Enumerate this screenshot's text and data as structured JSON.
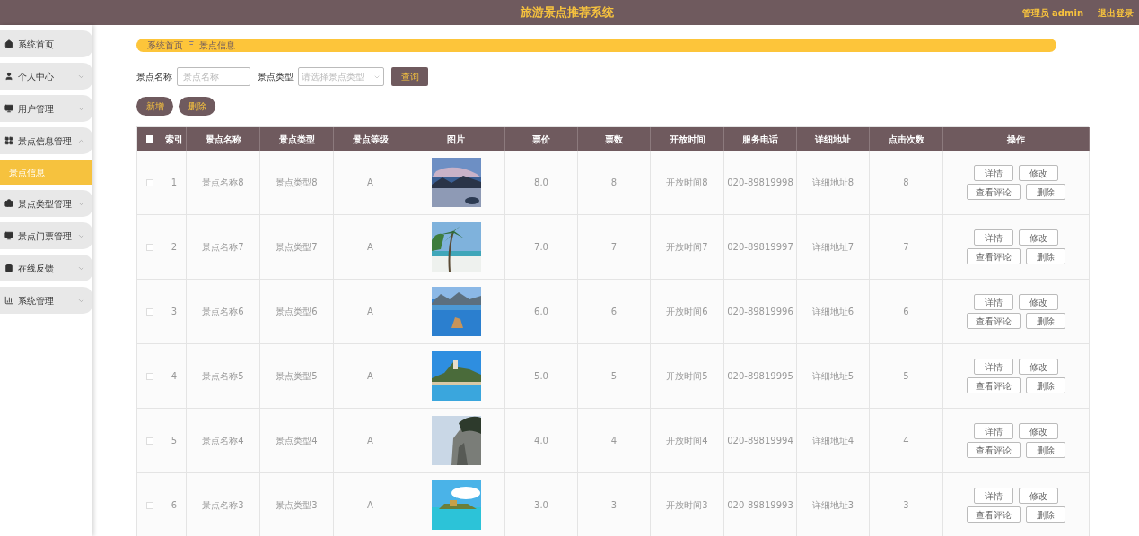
{
  "header": {
    "title": "旅游景点推荐系统",
    "user": "管理员 admin",
    "logout": "退出登录"
  },
  "sidebar": {
    "items": [
      {
        "label": "系统首页",
        "selected": false
      },
      {
        "label": "个人中心",
        "selected": false,
        "expanded": false
      },
      {
        "label": "用户管理",
        "selected": false,
        "expanded": false
      },
      {
        "label": "景点信息管理",
        "selected": false,
        "expanded": true,
        "children": [
          {
            "label": "景点信息",
            "selected": true
          }
        ]
      },
      {
        "label": "景点类型管理",
        "selected": false,
        "expanded": false
      },
      {
        "label": "景点门票管理",
        "selected": false,
        "expanded": false
      },
      {
        "label": "在线反馈",
        "selected": false,
        "expanded": false
      },
      {
        "label": "系统管理",
        "selected": false,
        "expanded": false
      }
    ]
  },
  "breadcrumb": [
    "系统首页",
    "景点信息"
  ],
  "breadcrumb_separator": "Ξ",
  "filters": [
    {
      "label": "景点名称",
      "kind": "input",
      "placeholder": "景点名称"
    },
    {
      "label": "景点类型",
      "kind": "select",
      "placeholder": "请选择景点类型"
    }
  ],
  "search_button": "查询",
  "actions": [
    "新增",
    "删除"
  ],
  "table": {
    "select_all": {
      "checked": false
    },
    "columns": [
      "索引",
      "景点名称",
      "景点类型",
      "景点等级",
      "图片",
      "票价",
      "票数",
      "开放时间",
      "服务电话",
      "详细地址",
      "点击次数",
      "操作"
    ],
    "rows": [
      {
        "checked": false,
        "cells": [
          "1",
          "景点名称8",
          "景点类型8",
          "A",
          {
            "kind": "picture"
          },
          "8.0",
          "8",
          "开放时间8",
          "020-89819998",
          "详细地址8",
          "8"
        ],
        "buttons": [
          "详情",
          "修改",
          "查看评论",
          "删除"
        ]
      },
      {
        "checked": false,
        "cells": [
          "2",
          "景点名称7",
          "景点类型7",
          "A",
          {
            "kind": "picture"
          },
          "7.0",
          "7",
          "开放时间7",
          "020-89819997",
          "详细地址7",
          "7"
        ],
        "buttons": [
          "详情",
          "修改",
          "查看评论",
          "删除"
        ]
      },
      {
        "checked": false,
        "cells": [
          "3",
          "景点名称6",
          "景点类型6",
          "A",
          {
            "kind": "picture"
          },
          "6.0",
          "6",
          "开放时间6",
          "020-89819996",
          "详细地址6",
          "6"
        ],
        "buttons": [
          "详情",
          "修改",
          "查看评论",
          "删除"
        ]
      },
      {
        "checked": false,
        "cells": [
          "4",
          "景点名称5",
          "景点类型5",
          "A",
          {
            "kind": "picture"
          },
          "5.0",
          "5",
          "开放时间5",
          "020-89819995",
          "详细地址5",
          "5"
        ],
        "buttons": [
          "详情",
          "修改",
          "查看评论",
          "删除"
        ]
      },
      {
        "checked": false,
        "cells": [
          "5",
          "景点名称4",
          "景点类型4",
          "A",
          {
            "kind": "picture"
          },
          "4.0",
          "4",
          "开放时间4",
          "020-89819994",
          "详细地址4",
          "4"
        ],
        "buttons": [
          "详情",
          "修改",
          "查看评论",
          "删除"
        ]
      },
      {
        "checked": false,
        "cells": [
          "6",
          "景点名称3",
          "景点类型3",
          "A",
          {
            "kind": "picture"
          },
          "3.0",
          "3",
          "开放时间3",
          "020-89819993",
          "详细地址3",
          "3"
        ],
        "buttons": [
          "详情",
          "修改",
          "查看评论",
          "删除"
        ]
      }
    ]
  }
}
